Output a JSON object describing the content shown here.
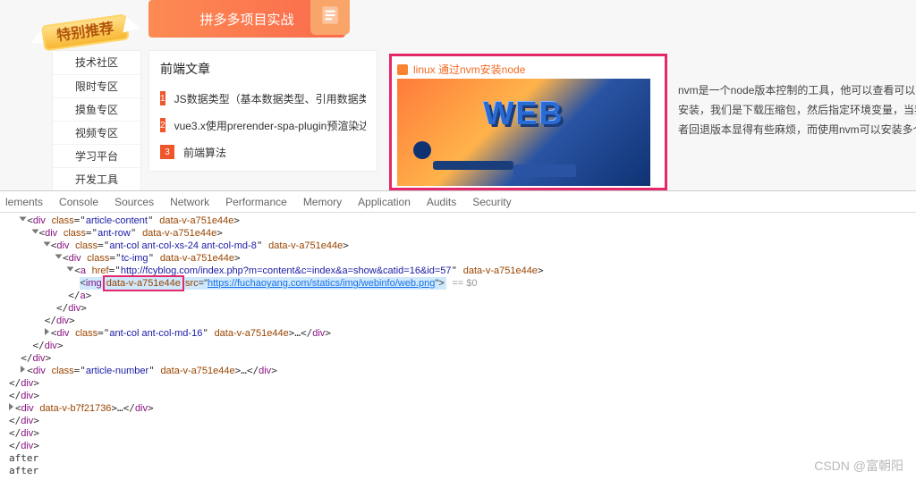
{
  "top_band_title": "拼多多项目实战",
  "badge_text": "特别推荐",
  "sidebar": {
    "items": [
      "技术社区",
      "限时专区",
      "摸鱼专区",
      "视频专区",
      "学习平台",
      "开发工具"
    ]
  },
  "card": {
    "title": "前端文章",
    "rows": [
      {
        "n": "1",
        "label": "JS数据类型（基本数据类型、引用数据类"
      },
      {
        "n": "2",
        "label": "vue3.x使用prerender-spa-plugin预渲染达"
      },
      {
        "n": "3",
        "label": "前端算法"
      }
    ]
  },
  "preview": {
    "title": "linux 通过nvm安装node",
    "web_text": "WEB"
  },
  "right_text": {
    "l1": "nvm是一个node版本控制的工具，他可以查看可以安装的no",
    "l2": "安装，我们是下载压缩包，然后指定环境变量，当我们需要",
    "l3": "者回退版本显得有些麻烦，而使用nvm可以安装多个node，"
  },
  "devtools": {
    "tabs": [
      "lements",
      "Console",
      "Sources",
      "Network",
      "Performance",
      "Memory",
      "Application",
      "Audits",
      "Security"
    ],
    "attr_highlight": "data-v-a751e44e",
    "href_val": "http://fcyblog.com/index.php?m=content&c=index&a=show&catid=16&id=57",
    "src_val": "https://fuchaoyang.com/statics/img/webinfo/web.png",
    "scope_attr": "data-v-a751e44e",
    "scope_attr2": "data-v-b7f21736"
  },
  "watermark": "CSDN @富朝阳"
}
